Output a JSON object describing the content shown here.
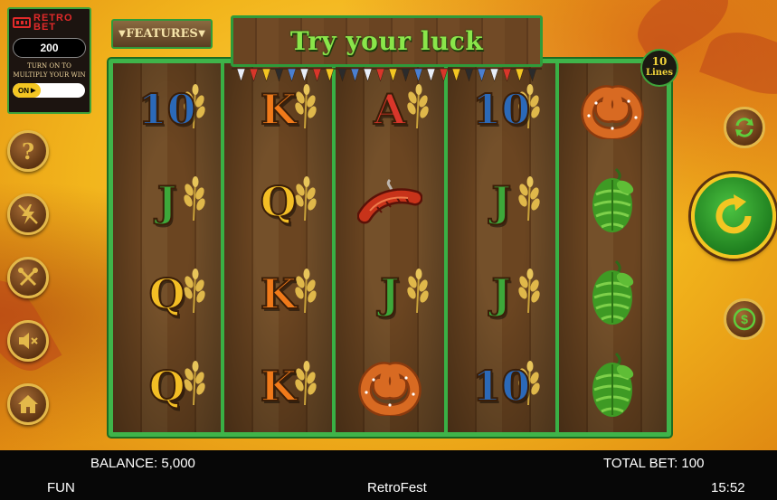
{
  "retro_bet": {
    "logo": "RETRO\nBET",
    "value": "200",
    "caption": "Turn on to multiply your win",
    "toggle": "ON"
  },
  "features_label": "FEATURES",
  "banner_title": "Try your luck",
  "lines": {
    "count": "10",
    "label": "Lines"
  },
  "reels": [
    [
      "10",
      "J",
      "Q",
      "Q"
    ],
    [
      "K",
      "Q",
      "K",
      "K"
    ],
    [
      "A",
      "sausage",
      "J",
      "pretzel"
    ],
    [
      "10",
      "J",
      "J",
      "10"
    ],
    [
      "pretzel",
      "hops",
      "hops",
      "hops"
    ]
  ],
  "left_buttons": [
    "help-icon",
    "lightning-icon",
    "settings-icon",
    "sound-off-icon",
    "home-icon"
  ],
  "right_buttons": [
    "autoplay-icon",
    "spin-icon",
    "coin-icon"
  ],
  "bottom_bar": {
    "balance": "BALANCE: 5,000",
    "total_bet": "TOTAL BET: 100",
    "mode": "FUN",
    "game_name": "RetroFest",
    "time": "15:52"
  },
  "colors": {
    "frame_green": "#3fb44a",
    "banner_text": "#8ae64a",
    "gold": "#f3c622",
    "background": "#f2b51c"
  }
}
